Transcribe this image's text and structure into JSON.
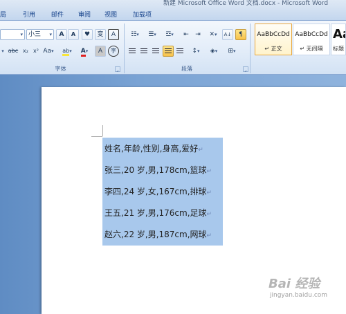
{
  "window": {
    "title": "新建 Microsoft Office Word 文档.docx - Microsoft Word"
  },
  "tabs": [
    "局",
    "引用",
    "邮件",
    "审阅",
    "视图",
    "加载项"
  ],
  "font_group": {
    "label": "字体",
    "font_size": "小三",
    "grow_font": "A",
    "shrink_font": "A",
    "clear_format": "♥",
    "phonetic": "变",
    "char_border": "A",
    "strike": "abc",
    "subscript": "x₂",
    "superscript": "x²",
    "change_case": "Aa",
    "highlight": "ab",
    "font_color": "A",
    "char_shading": "A",
    "enclose": "字"
  },
  "paragraph_group": {
    "label": "段落",
    "sort": "A↓",
    "show_marks": "¶"
  },
  "styles": [
    {
      "sample": "AaBbCcDd",
      "name": "↵ 正文",
      "selected": true
    },
    {
      "sample": "AaBbCcDd",
      "name": "↵ 无间隔",
      "selected": false
    },
    {
      "sample": "Aa",
      "name": "标题",
      "selected": false
    }
  ],
  "document": {
    "lines": [
      "姓名,年龄,性别,身高,爱好",
      "张三,20 岁,男,178cm,篮球",
      "李四,24 岁,女,167cm,排球",
      "王五,21 岁,男,176cm,足球",
      "赵六,22 岁,男,187cm,网球"
    ],
    "paragraph_mark": "↵",
    "selection_color": "#a8c8ec"
  },
  "watermark": {
    "text": "Bai 经验",
    "cn": "经验",
    "sub": "jingyan.baidu.com"
  },
  "colors": {
    "ribbon_accent": "#15428b",
    "highlight_yellow": "#f8e53a",
    "font_red": "#e02020"
  }
}
